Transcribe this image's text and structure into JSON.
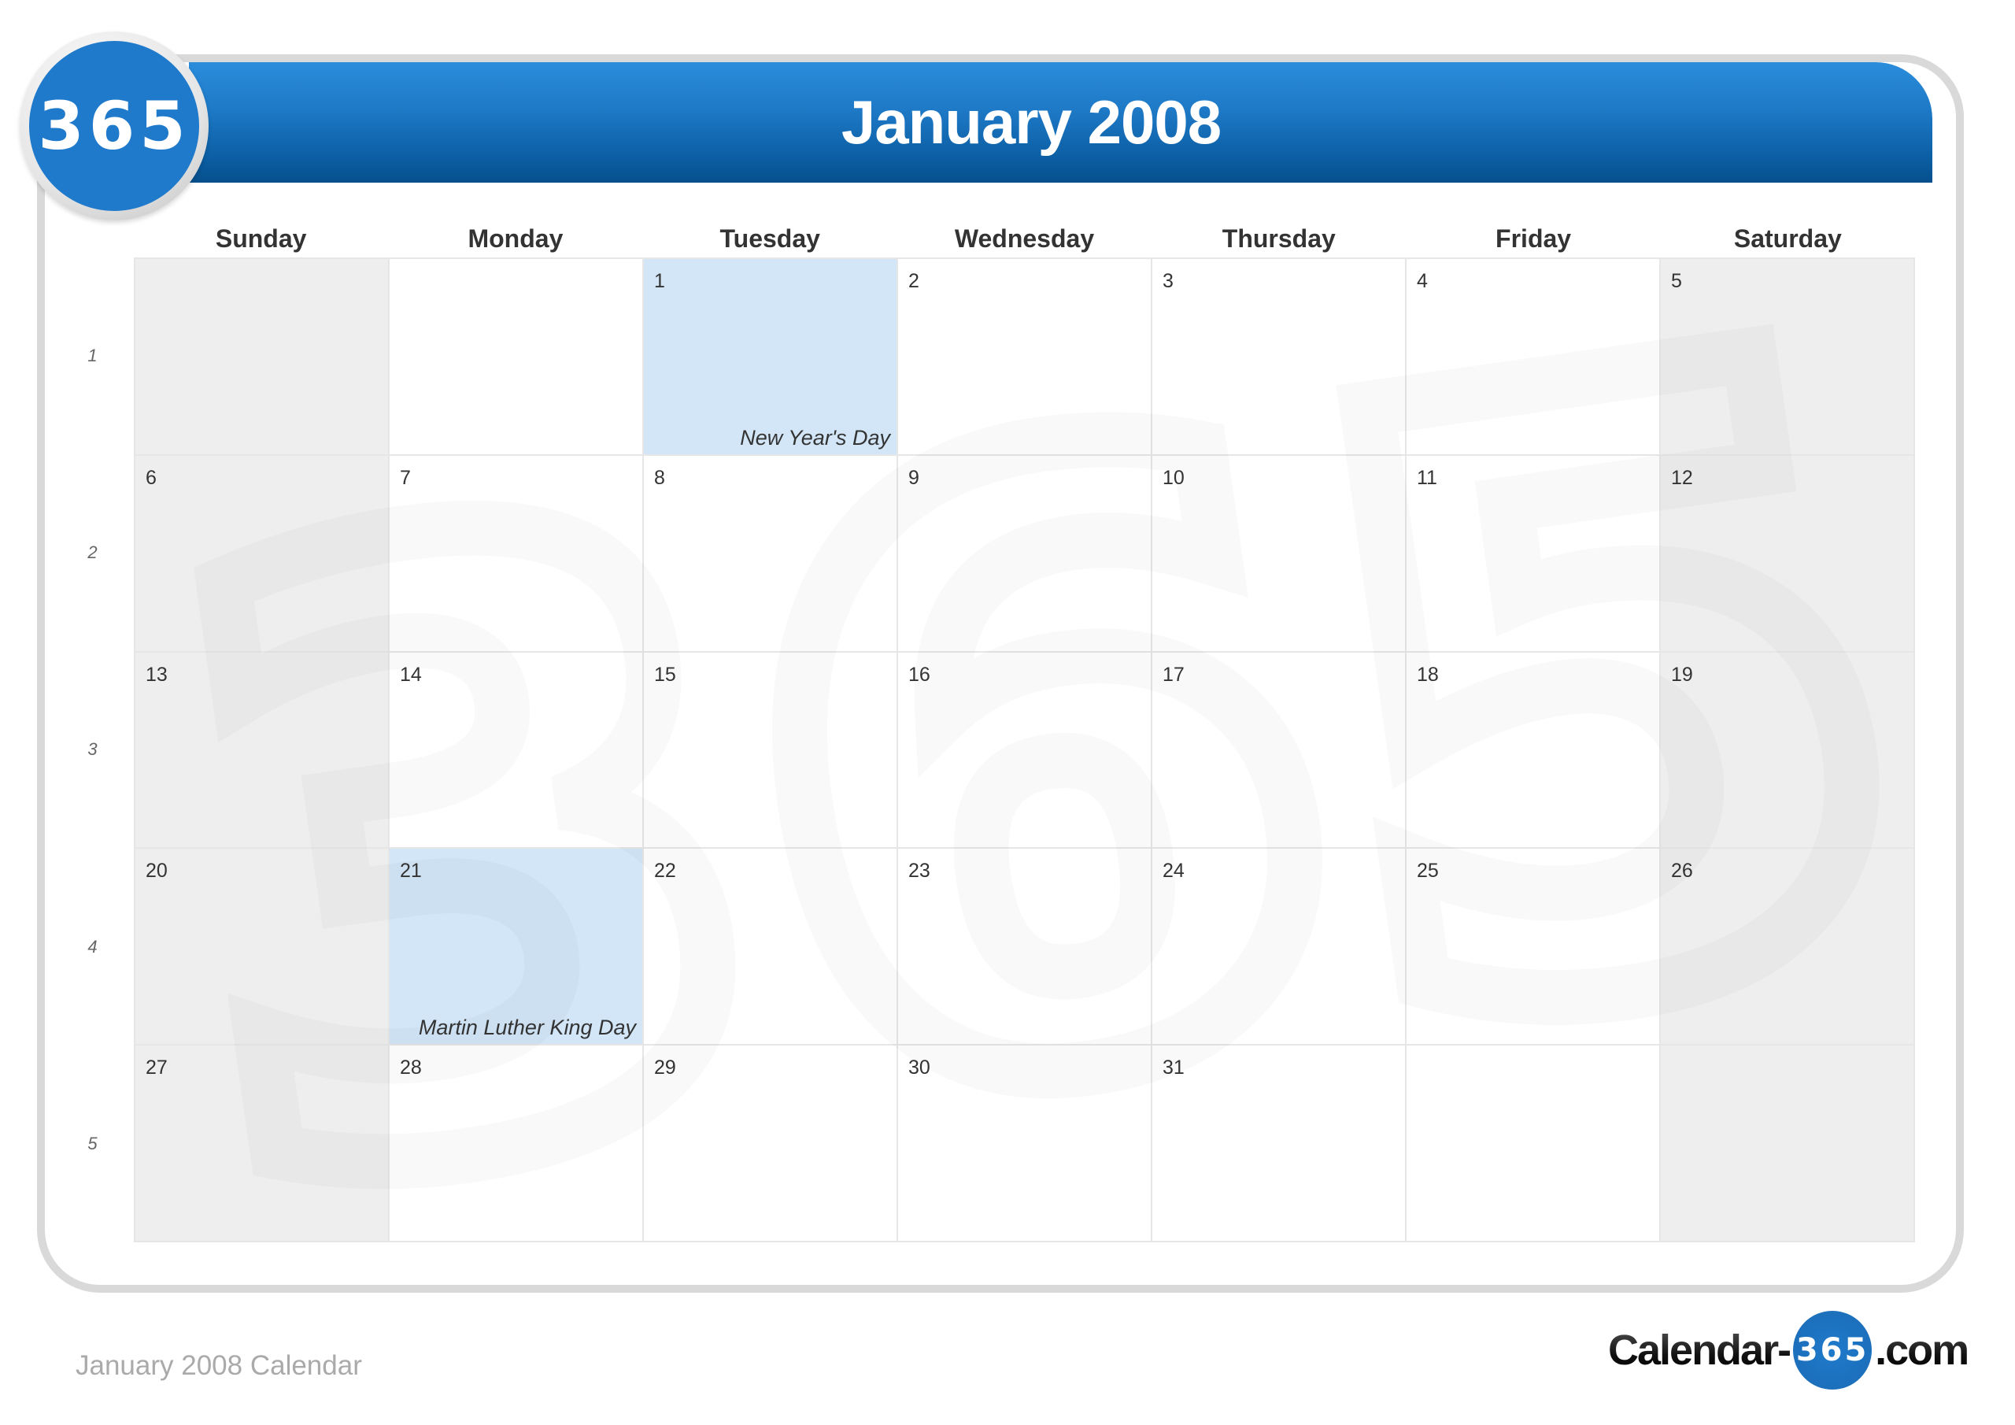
{
  "header": {
    "badge": "365",
    "title": "January 2008"
  },
  "weekdays": [
    "Sunday",
    "Monday",
    "Tuesday",
    "Wednesday",
    "Thursday",
    "Friday",
    "Saturday"
  ],
  "week_numbers": [
    "1",
    "2",
    "3",
    "4",
    "5"
  ],
  "weeks": [
    [
      {
        "day": ""
      },
      {
        "day": ""
      },
      {
        "day": "1",
        "holiday": "New Year's Day"
      },
      {
        "day": "2"
      },
      {
        "day": "3"
      },
      {
        "day": "4"
      },
      {
        "day": "5"
      }
    ],
    [
      {
        "day": "6"
      },
      {
        "day": "7"
      },
      {
        "day": "8"
      },
      {
        "day": "9"
      },
      {
        "day": "10"
      },
      {
        "day": "11"
      },
      {
        "day": "12"
      }
    ],
    [
      {
        "day": "13"
      },
      {
        "day": "14"
      },
      {
        "day": "15"
      },
      {
        "day": "16"
      },
      {
        "day": "17"
      },
      {
        "day": "18"
      },
      {
        "day": "19"
      }
    ],
    [
      {
        "day": "20"
      },
      {
        "day": "21",
        "holiday": "Martin Luther King Day"
      },
      {
        "day": "22"
      },
      {
        "day": "23"
      },
      {
        "day": "24"
      },
      {
        "day": "25"
      },
      {
        "day": "26"
      }
    ],
    [
      {
        "day": "27"
      },
      {
        "day": "28"
      },
      {
        "day": "29"
      },
      {
        "day": "30"
      },
      {
        "day": "31"
      },
      {
        "day": ""
      },
      {
        "day": ""
      }
    ]
  ],
  "colors": {
    "header_blue": "#1f7acb",
    "holiday_highlight": "#d2e6f7",
    "weekend_fill": "#efefef"
  },
  "footer": {
    "caption": "January 2008 Calendar",
    "brand_prefix": "Calendar-",
    "brand_badge": "365",
    "brand_suffix": ".com"
  },
  "watermark": "365"
}
